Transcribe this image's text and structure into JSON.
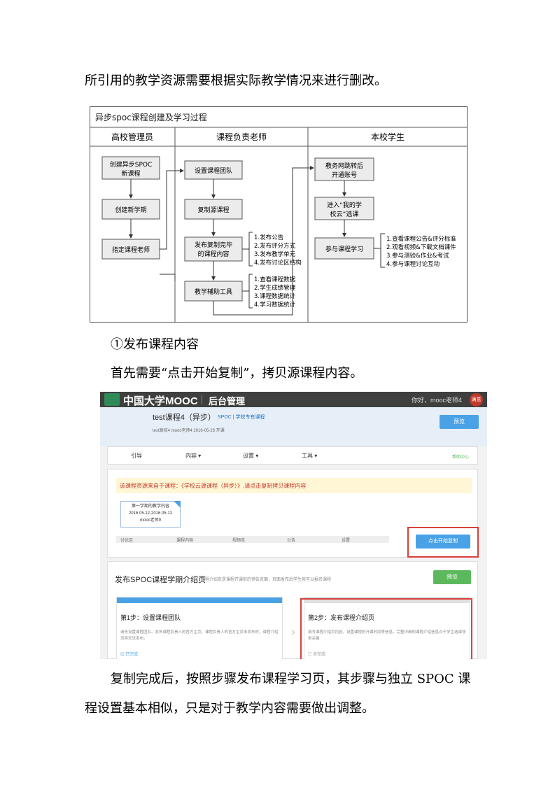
{
  "paragraphs": {
    "p1": "所引用的教学资源需要根据实际教学情况来进行删改。",
    "p2": "①发布课程内容",
    "p3": "首先需要“点击开始复制”，拷贝源课程内容。",
    "p4": "复制完成后，按照步骤发布课程学习页，其步骤与独立 SPOC 课",
    "p5": "程设置基本相似，只是对于教学内容需要做出调整。"
  },
  "flowchart": {
    "title": "异步spoc课程创建及学习过程",
    "lanes": [
      "高校管理员",
      "课程负责老师",
      "本校学生"
    ],
    "admin_steps": [
      "创建异步SPOC",
      "新课程",
      "创建新学期",
      "指定课程老师"
    ],
    "teacher_steps": [
      "设置课程团队",
      "复制源课程",
      "发布复制完毕",
      "的课程内容",
      "教学辅助工具"
    ],
    "publish_items": [
      "1.发布公告",
      "2.发布评分方式",
      "3.发布教学单元",
      "4.发布讨论区结构"
    ],
    "tool_items": [
      "1.查看课程数据",
      "2.学生成绩管理",
      "3.课程数据统计",
      "4.学习数据统计"
    ],
    "student_steps": [
      "教务网跳转后",
      "开通账号",
      "进入“我的学",
      "校云”选课",
      "参与课程学习"
    ],
    "learn_items": [
      "1.查看课程公告&评分标准",
      "2.观看视频&下载文档课件",
      "3.参与测验&作业&考试",
      "4.参与课程讨论互动"
    ]
  },
  "screenshot": {
    "logo": "中国大学MOOC",
    "logo_sub": "后台管理",
    "greeting": "你好，mooc老师4",
    "avatar": "满意",
    "course_title": "test课程4（异步）",
    "course_tag": "SPOC | 学校专有课程",
    "course_info": "test高校4   mooc老师4   2016-05-26 开课",
    "preview_label": "预览",
    "nav": [
      "引导",
      "内容 ▾",
      "设置 ▾",
      "工具 ▾"
    ],
    "help": "帮助中心",
    "notice": "该课程资源来自于课程：《学校云源课程（异步）》,请点击复制拷贝课程内容",
    "term_lines": [
      "第一学期的教学内容",
      "2016.05.12-2016.05.12",
      "mooc老师9"
    ],
    "tabs": [
      "讨论区",
      "课程内容",
      "视频库",
      "公告",
      "设置"
    ],
    "copy_button": "点击开始复制",
    "section_title": "发布SPOC课程学期介绍页",
    "section_sub": "课程介绍页是课程开课前的预告页面，页面发布后学生就可以报名课程",
    "preview2_label": "预览",
    "step1_title": "第1步：设置课程团队",
    "step1_desc": "请先设置课程团队。发布课程负责人的官方主页，课程负责人的官方主页未发布时，课程介绍页将无法发布。",
    "step1_status": "☑ 已完成",
    "step2_title": "第2步：发布课程介绍页",
    "step2_desc": "填写课程介绍页内容，设置课程的开课时间等信息，完整详细的课程介绍信息对于学生选课非常关键",
    "step2_status": "☐ 未完成",
    "colors": {
      "highlight": "#d9403a",
      "accent": "#4aa2e6",
      "green": "#5cb85c"
    }
  }
}
